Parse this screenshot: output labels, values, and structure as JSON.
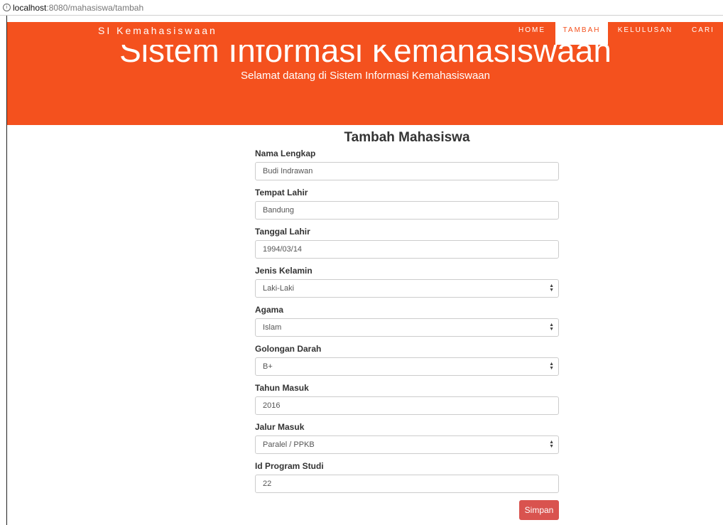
{
  "browser": {
    "url_host": "localhost",
    "url_path": ":8080/mahasiswa/tambah"
  },
  "navbar": {
    "brand": "SI Kemahasiswaan",
    "items": [
      {
        "label": "HOME",
        "active": false
      },
      {
        "label": "TAMBAH",
        "active": true
      },
      {
        "label": "KELULUSAN",
        "active": false
      },
      {
        "label": "CARI",
        "active": false
      }
    ]
  },
  "hero": {
    "title": "Sistem Informasi Kemahasiswaan",
    "subtitle": "Selamat datang di Sistem Informasi Kemahasiswaan"
  },
  "form": {
    "title": "Tambah Mahasiswa",
    "fields": [
      {
        "label": "Nama Lengkap",
        "value": "Budi Indrawan",
        "type": "text"
      },
      {
        "label": "Tempat Lahir",
        "value": "Bandung",
        "type": "text"
      },
      {
        "label": "Tanggal Lahir",
        "value": "1994/03/14",
        "type": "text"
      },
      {
        "label": "Jenis Kelamin",
        "value": "Laki-Laki",
        "type": "select"
      },
      {
        "label": "Agama",
        "value": "Islam",
        "type": "select"
      },
      {
        "label": "Golongan Darah",
        "value": "B+",
        "type": "select"
      },
      {
        "label": "Tahun Masuk",
        "value": "2016",
        "type": "text"
      },
      {
        "label": "Jalur Masuk",
        "value": "Paralel / PPKB",
        "type": "select"
      },
      {
        "label": "Id Program Studi",
        "value": "22",
        "type": "text"
      }
    ],
    "submit_label": "Simpan"
  },
  "colors": {
    "brand": "#f4511e",
    "submit": "#d9534f"
  },
  "icons": {
    "url_info": "info-icon",
    "select_arrow": "select-arrow-icon"
  }
}
